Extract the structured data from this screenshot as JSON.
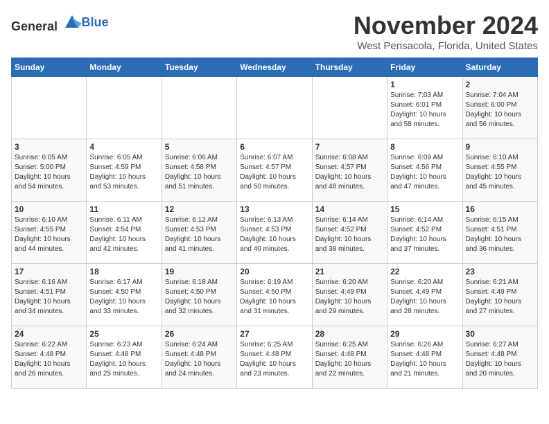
{
  "logo": {
    "text_general": "General",
    "text_blue": "Blue"
  },
  "header": {
    "month": "November 2024",
    "location": "West Pensacola, Florida, United States"
  },
  "weekdays": [
    "Sunday",
    "Monday",
    "Tuesday",
    "Wednesday",
    "Thursday",
    "Friday",
    "Saturday"
  ],
  "weeks": [
    [
      {
        "day": "",
        "info": ""
      },
      {
        "day": "",
        "info": ""
      },
      {
        "day": "",
        "info": ""
      },
      {
        "day": "",
        "info": ""
      },
      {
        "day": "",
        "info": ""
      },
      {
        "day": "1",
        "info": "Sunrise: 7:03 AM\nSunset: 6:01 PM\nDaylight: 10 hours and 58 minutes."
      },
      {
        "day": "2",
        "info": "Sunrise: 7:04 AM\nSunset: 6:00 PM\nDaylight: 10 hours and 56 minutes."
      }
    ],
    [
      {
        "day": "3",
        "info": "Sunrise: 6:05 AM\nSunset: 5:00 PM\nDaylight: 10 hours and 54 minutes."
      },
      {
        "day": "4",
        "info": "Sunrise: 6:05 AM\nSunset: 4:59 PM\nDaylight: 10 hours and 53 minutes."
      },
      {
        "day": "5",
        "info": "Sunrise: 6:06 AM\nSunset: 4:58 PM\nDaylight: 10 hours and 51 minutes."
      },
      {
        "day": "6",
        "info": "Sunrise: 6:07 AM\nSunset: 4:57 PM\nDaylight: 10 hours and 50 minutes."
      },
      {
        "day": "7",
        "info": "Sunrise: 6:08 AM\nSunset: 4:57 PM\nDaylight: 10 hours and 48 minutes."
      },
      {
        "day": "8",
        "info": "Sunrise: 6:09 AM\nSunset: 4:56 PM\nDaylight: 10 hours and 47 minutes."
      },
      {
        "day": "9",
        "info": "Sunrise: 6:10 AM\nSunset: 4:55 PM\nDaylight: 10 hours and 45 minutes."
      }
    ],
    [
      {
        "day": "10",
        "info": "Sunrise: 6:10 AM\nSunset: 4:55 PM\nDaylight: 10 hours and 44 minutes."
      },
      {
        "day": "11",
        "info": "Sunrise: 6:11 AM\nSunset: 4:54 PM\nDaylight: 10 hours and 42 minutes."
      },
      {
        "day": "12",
        "info": "Sunrise: 6:12 AM\nSunset: 4:53 PM\nDaylight: 10 hours and 41 minutes."
      },
      {
        "day": "13",
        "info": "Sunrise: 6:13 AM\nSunset: 4:53 PM\nDaylight: 10 hours and 40 minutes."
      },
      {
        "day": "14",
        "info": "Sunrise: 6:14 AM\nSunset: 4:52 PM\nDaylight: 10 hours and 38 minutes."
      },
      {
        "day": "15",
        "info": "Sunrise: 6:14 AM\nSunset: 4:52 PM\nDaylight: 10 hours and 37 minutes."
      },
      {
        "day": "16",
        "info": "Sunrise: 6:15 AM\nSunset: 4:51 PM\nDaylight: 10 hours and 36 minutes."
      }
    ],
    [
      {
        "day": "17",
        "info": "Sunrise: 6:16 AM\nSunset: 4:51 PM\nDaylight: 10 hours and 34 minutes."
      },
      {
        "day": "18",
        "info": "Sunrise: 6:17 AM\nSunset: 4:50 PM\nDaylight: 10 hours and 33 minutes."
      },
      {
        "day": "19",
        "info": "Sunrise: 6:18 AM\nSunset: 4:50 PM\nDaylight: 10 hours and 32 minutes."
      },
      {
        "day": "20",
        "info": "Sunrise: 6:19 AM\nSunset: 4:50 PM\nDaylight: 10 hours and 31 minutes."
      },
      {
        "day": "21",
        "info": "Sunrise: 6:20 AM\nSunset: 4:49 PM\nDaylight: 10 hours and 29 minutes."
      },
      {
        "day": "22",
        "info": "Sunrise: 6:20 AM\nSunset: 4:49 PM\nDaylight: 10 hours and 28 minutes."
      },
      {
        "day": "23",
        "info": "Sunrise: 6:21 AM\nSunset: 4:49 PM\nDaylight: 10 hours and 27 minutes."
      }
    ],
    [
      {
        "day": "24",
        "info": "Sunrise: 6:22 AM\nSunset: 4:48 PM\nDaylight: 10 hours and 26 minutes."
      },
      {
        "day": "25",
        "info": "Sunrise: 6:23 AM\nSunset: 4:48 PM\nDaylight: 10 hours and 25 minutes."
      },
      {
        "day": "26",
        "info": "Sunrise: 6:24 AM\nSunset: 4:48 PM\nDaylight: 10 hours and 24 minutes."
      },
      {
        "day": "27",
        "info": "Sunrise: 6:25 AM\nSunset: 4:48 PM\nDaylight: 10 hours and 23 minutes."
      },
      {
        "day": "28",
        "info": "Sunrise: 6:25 AM\nSunset: 4:48 PM\nDaylight: 10 hours and 22 minutes."
      },
      {
        "day": "29",
        "info": "Sunrise: 6:26 AM\nSunset: 4:48 PM\nDaylight: 10 hours and 21 minutes."
      },
      {
        "day": "30",
        "info": "Sunrise: 6:27 AM\nSunset: 4:48 PM\nDaylight: 10 hours and 20 minutes."
      }
    ]
  ]
}
